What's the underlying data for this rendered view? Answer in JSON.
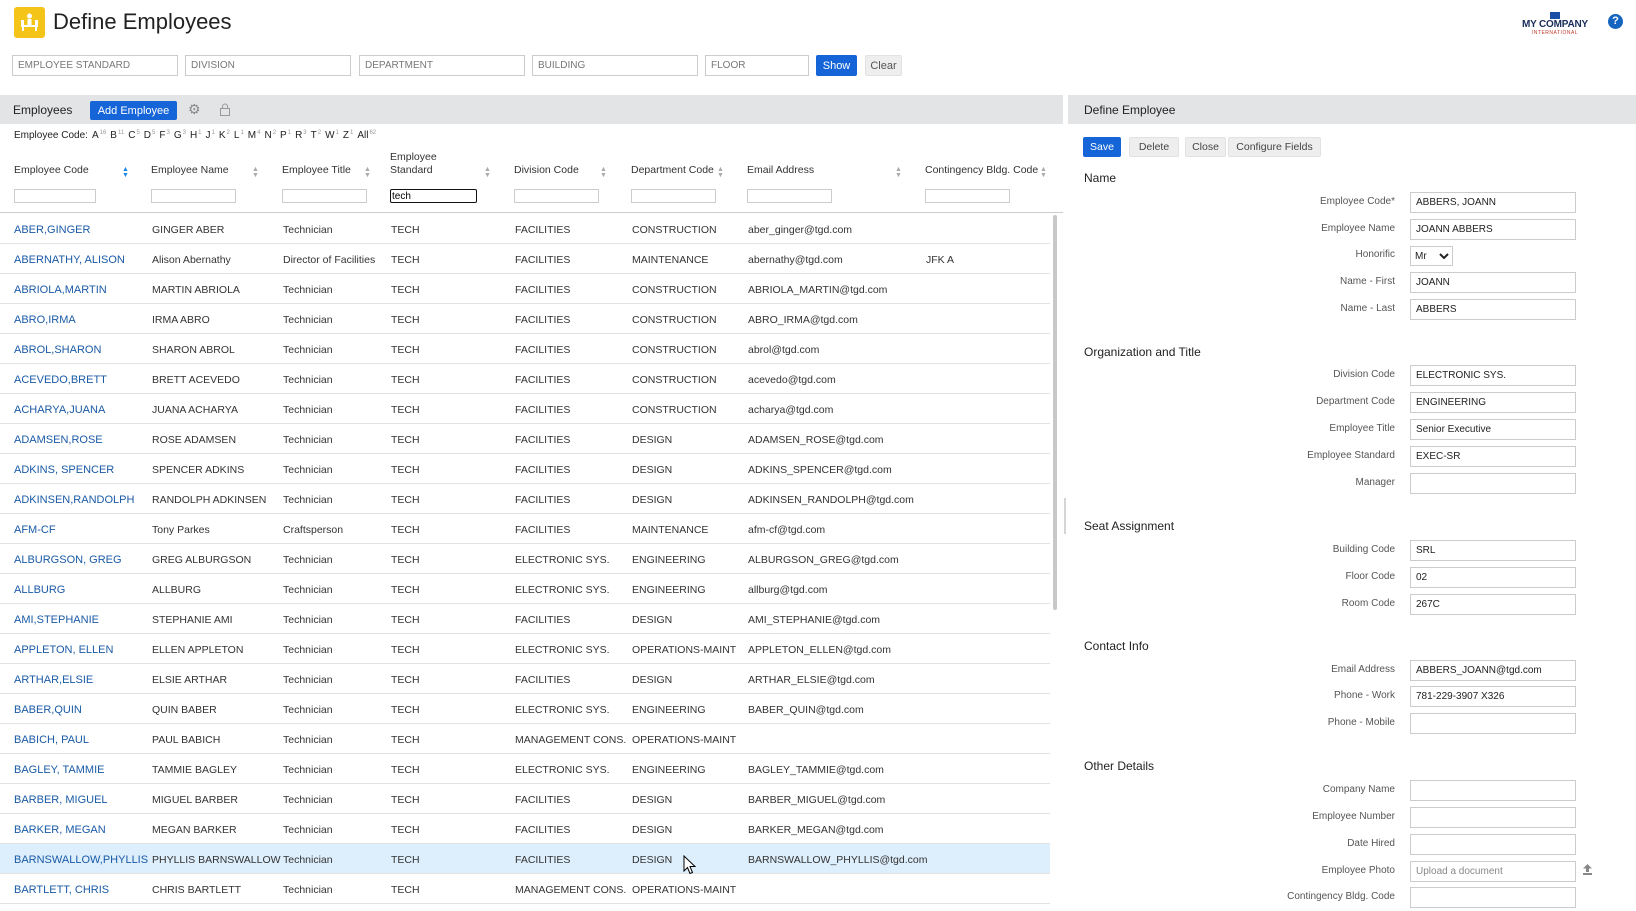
{
  "header": {
    "title": "Define Employees",
    "company_name": "MY COMPANY",
    "company_sub": "INTERNATIONAL",
    "help_label": "?"
  },
  "filters": {
    "employee_standard": "EMPLOYEE STANDARD",
    "division": "DIVISION",
    "department": "DEPARTMENT",
    "building": "BUILDING",
    "floor": "FLOOR",
    "show_label": "Show",
    "clear_label": "Clear"
  },
  "list": {
    "title": "Employees",
    "add_label": "Add Employee",
    "alpha_label": "Employee Code:",
    "alpha": [
      {
        "letter": "A",
        "count": "16"
      },
      {
        "letter": "B",
        "count": "11"
      },
      {
        "letter": "C",
        "count": "5"
      },
      {
        "letter": "D",
        "count": "5"
      },
      {
        "letter": "F",
        "count": "3"
      },
      {
        "letter": "G",
        "count": "3"
      },
      {
        "letter": "H",
        "count": "1"
      },
      {
        "letter": "J",
        "count": "1"
      },
      {
        "letter": "K",
        "count": "2"
      },
      {
        "letter": "L",
        "count": "1"
      },
      {
        "letter": "M",
        "count": "4"
      },
      {
        "letter": "N",
        "count": "2"
      },
      {
        "letter": "P",
        "count": "1"
      },
      {
        "letter": "R",
        "count": "3"
      },
      {
        "letter": "T",
        "count": "2"
      },
      {
        "letter": "W",
        "count": "1"
      },
      {
        "letter": "Z",
        "count": "1"
      },
      {
        "letter": "All",
        "count": "62"
      }
    ],
    "columns": {
      "code": "Employee Code",
      "name": "Employee Name",
      "title": "Employee Title",
      "standard": "Employee Standard",
      "division": "Division Code",
      "department": "Department Code",
      "email": "Email Address",
      "contingency": "Contingency Bldg. Code"
    },
    "standard_filter_value": "tech",
    "rows": [
      {
        "code": "ABER,GINGER",
        "name": "GINGER ABER",
        "title": "Technician",
        "std": "TECH",
        "div": "FACILITIES",
        "dept": "CONSTRUCTION",
        "email": "aber_ginger@tgd.com",
        "cont": ""
      },
      {
        "code": "ABERNATHY, ALISON",
        "name": "Alison Abernathy",
        "title": "Director of Facilities",
        "std": "TECH",
        "div": "FACILITIES",
        "dept": "MAINTENANCE",
        "email": "abernathy@tgd.com",
        "cont": "JFK A"
      },
      {
        "code": "ABRIOLA,MARTIN",
        "name": "MARTIN ABRIOLA",
        "title": "Technician",
        "std": "TECH",
        "div": "FACILITIES",
        "dept": "CONSTRUCTION",
        "email": "ABRIOLA_MARTIN@tgd.com",
        "cont": ""
      },
      {
        "code": "ABRO,IRMA",
        "name": "IRMA ABRO",
        "title": "Technician",
        "std": "TECH",
        "div": "FACILITIES",
        "dept": "CONSTRUCTION",
        "email": "ABRO_IRMA@tgd.com",
        "cont": ""
      },
      {
        "code": "ABROL,SHARON",
        "name": "SHARON ABROL",
        "title": "Technician",
        "std": "TECH",
        "div": "FACILITIES",
        "dept": "CONSTRUCTION",
        "email": "abrol@tgd.com",
        "cont": ""
      },
      {
        "code": "ACEVEDO,BRETT",
        "name": "BRETT ACEVEDO",
        "title": "Technician",
        "std": "TECH",
        "div": "FACILITIES",
        "dept": "CONSTRUCTION",
        "email": "acevedo@tgd.com",
        "cont": ""
      },
      {
        "code": "ACHARYA,JUANA",
        "name": "JUANA ACHARYA",
        "title": "Technician",
        "std": "TECH",
        "div": "FACILITIES",
        "dept": "CONSTRUCTION",
        "email": "acharya@tgd.com",
        "cont": ""
      },
      {
        "code": "ADAMSEN,ROSE",
        "name": "ROSE ADAMSEN",
        "title": "Technician",
        "std": "TECH",
        "div": "FACILITIES",
        "dept": "DESIGN",
        "email": "ADAMSEN_ROSE@tgd.com",
        "cont": ""
      },
      {
        "code": "ADKINS, SPENCER",
        "name": "SPENCER ADKINS",
        "title": "Technician",
        "std": "TECH",
        "div": "FACILITIES",
        "dept": "DESIGN",
        "email": "ADKINS_SPENCER@tgd.com",
        "cont": ""
      },
      {
        "code": "ADKINSEN,RANDOLPH",
        "name": "RANDOLPH ADKINSEN",
        "title": "Technician",
        "std": "TECH",
        "div": "FACILITIES",
        "dept": "DESIGN",
        "email": "ADKINSEN_RANDOLPH@tgd.com",
        "cont": ""
      },
      {
        "code": "AFM-CF",
        "name": "Tony Parkes",
        "title": "Craftsperson",
        "std": "TECH",
        "div": "FACILITIES",
        "dept": "MAINTENANCE",
        "email": "afm-cf@tgd.com",
        "cont": ""
      },
      {
        "code": "ALBURGSON, GREG",
        "name": "GREG ALBURGSON",
        "title": "Technician",
        "std": "TECH",
        "div": "ELECTRONIC SYS.",
        "dept": "ENGINEERING",
        "email": "ALBURGSON_GREG@tgd.com",
        "cont": ""
      },
      {
        "code": "ALLBURG",
        "name": "ALLBURG",
        "title": "Technician",
        "std": "TECH",
        "div": "ELECTRONIC SYS.",
        "dept": "ENGINEERING",
        "email": "allburg@tgd.com",
        "cont": ""
      },
      {
        "code": "AMI,STEPHANIE",
        "name": "STEPHANIE AMI",
        "title": "Technician",
        "std": "TECH",
        "div": "FACILITIES",
        "dept": "DESIGN",
        "email": "AMI_STEPHANIE@tgd.com",
        "cont": ""
      },
      {
        "code": "APPLETON, ELLEN",
        "name": "ELLEN APPLETON",
        "title": "Technician",
        "std": "TECH",
        "div": "ELECTRONIC SYS.",
        "dept": "OPERATIONS-MAINT",
        "email": "APPLETON_ELLEN@tgd.com",
        "cont": ""
      },
      {
        "code": "ARTHAR,ELSIE",
        "name": "ELSIE ARTHAR",
        "title": "Technician",
        "std": "TECH",
        "div": "FACILITIES",
        "dept": "DESIGN",
        "email": "ARTHAR_ELSIE@tgd.com",
        "cont": ""
      },
      {
        "code": "BABER,QUIN",
        "name": "QUIN BABER",
        "title": "Technician",
        "std": "TECH",
        "div": "ELECTRONIC SYS.",
        "dept": "ENGINEERING",
        "email": "BABER_QUIN@tgd.com",
        "cont": ""
      },
      {
        "code": "BABICH, PAUL",
        "name": "PAUL BABICH",
        "title": "Technician",
        "std": "TECH",
        "div": "MANAGEMENT CONS.",
        "dept": "OPERATIONS-MAINT",
        "email": "",
        "cont": ""
      },
      {
        "code": "BAGLEY, TAMMIE",
        "name": "TAMMIE BAGLEY",
        "title": "Technician",
        "std": "TECH",
        "div": "ELECTRONIC SYS.",
        "dept": "ENGINEERING",
        "email": "BAGLEY_TAMMIE@tgd.com",
        "cont": ""
      },
      {
        "code": "BARBER, MIGUEL",
        "name": "MIGUEL BARBER",
        "title": "Technician",
        "std": "TECH",
        "div": "FACILITIES",
        "dept": "DESIGN",
        "email": "BARBER_MIGUEL@tgd.com",
        "cont": ""
      },
      {
        "code": "BARKER, MEGAN",
        "name": "MEGAN BARKER",
        "title": "Technician",
        "std": "TECH",
        "div": "FACILITIES",
        "dept": "DESIGN",
        "email": "BARKER_MEGAN@tgd.com",
        "cont": ""
      },
      {
        "code": "BARNSWALLOW,PHYLLIS",
        "name": "PHYLLIS BARNSWALLOW",
        "title": "Technician",
        "std": "TECH",
        "div": "FACILITIES",
        "dept": "DESIGN",
        "email": "BARNSWALLOW_PHYLLIS@tgd.com",
        "cont": "",
        "selected": true
      },
      {
        "code": "BARTLETT, CHRIS",
        "name": "CHRIS BARTLETT",
        "title": "Technician",
        "std": "TECH",
        "div": "MANAGEMENT CONS.",
        "dept": "OPERATIONS-MAINT",
        "email": "",
        "cont": ""
      }
    ]
  },
  "form": {
    "title": "Define Employee",
    "save_label": "Save",
    "delete_label": "Delete",
    "close_label": "Close",
    "configure_label": "Configure Fields",
    "sections": {
      "name": "Name",
      "organization": "Organization and Title",
      "seat": "Seat Assignment",
      "contact": "Contact Info",
      "other": "Other Details"
    },
    "labels": {
      "employee_code": "Employee Code*",
      "employee_name": "Employee Name",
      "honorific": "Honorific",
      "name_first": "Name - First",
      "name_last": "Name - Last",
      "division_code": "Division Code",
      "department_code": "Department Code",
      "employee_title": "Employee Title",
      "employee_standard": "Employee Standard",
      "manager": "Manager",
      "building_code": "Building Code",
      "floor_code": "Floor Code",
      "room_code": "Room Code",
      "email": "Email Address",
      "phone_work": "Phone - Work",
      "phone_mobile": "Phone - Mobile",
      "company_name": "Company Name",
      "employee_number": "Employee Number",
      "date_hired": "Date Hired",
      "employee_photo": "Employee Photo",
      "contingency": "Contingency Bldg. Code"
    },
    "values": {
      "employee_code": "ABBERS, JOANN",
      "employee_name": "JOANN ABBERS",
      "honorific": "Mr",
      "name_first": "JOANN",
      "name_last": "ABBERS",
      "division_code": "ELECTRONIC SYS.",
      "department_code": "ENGINEERING",
      "employee_title": "Senior Executive",
      "employee_standard": "EXEC-SR",
      "manager": "",
      "building_code": "SRL",
      "floor_code": "02",
      "room_code": "267C",
      "email": "ABBERS_JOANN@tgd.com",
      "phone_work": "781-229-3907 X326",
      "phone_mobile": "",
      "company_name": "",
      "employee_number": "",
      "date_hired": "",
      "contingency": ""
    },
    "photo_placeholder": "Upload a document"
  },
  "colors": {
    "accent": "#1565d8",
    "link": "#1a5aa6",
    "app_icon": "#f5c418",
    "selected_row": "#ddeefc",
    "panel_header": "#e3e4e6"
  }
}
